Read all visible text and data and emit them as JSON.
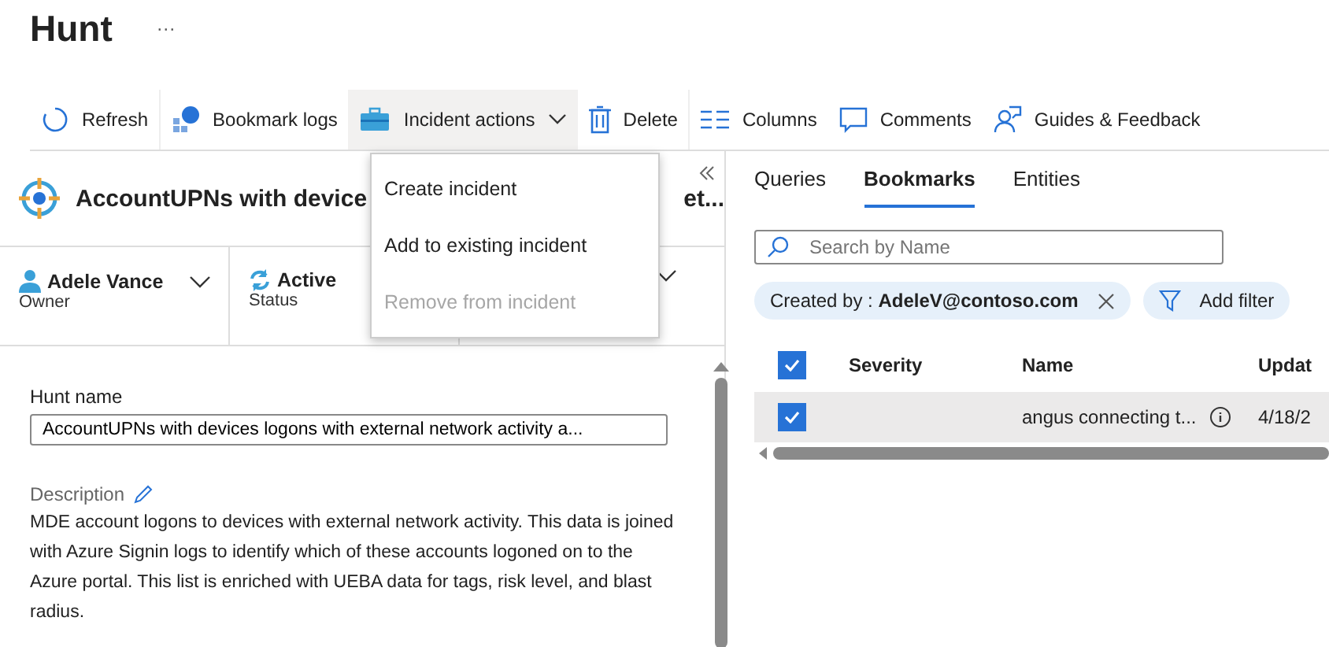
{
  "page_title": "Hunt",
  "more": "···",
  "toolbar": [
    {
      "label": "Refresh",
      "selected": false
    },
    {
      "label": "Bookmark logs",
      "selected": false
    },
    {
      "label": "Incident actions",
      "selected": true,
      "dropdown": true
    },
    {
      "label": "Delete",
      "selected": false
    },
    {
      "label": "Columns",
      "selected": false
    },
    {
      "label": "Comments",
      "selected": false
    },
    {
      "label": "Guides & Feedback",
      "selected": false
    }
  ],
  "menu": [
    {
      "label": "Create incident",
      "disabled": false
    },
    {
      "label": "Add to existing incident",
      "disabled": false
    },
    {
      "label": "Remove from incident",
      "disabled": true
    }
  ],
  "hunt": {
    "title_start": "AccountUPNs with device",
    "title_end": "et...",
    "cards": [
      {
        "value": "Adele Vance",
        "label": "Owner"
      },
      {
        "value": "Active",
        "label": "Status"
      }
    ],
    "name_label": "Hunt name",
    "name_value": "AccountUPNs with devices logons with external network activity a...",
    "description_label": "Description",
    "description": "MDE account logons to devices with external network activity. This data is joined with Azure Signin logs to identify which of these accounts logoned on to the Azure portal. This list is enriched with UEBA data for tags, risk level, and blast radius."
  },
  "tabs": [
    {
      "label": "Queries",
      "selected": false
    },
    {
      "label": "Bookmarks",
      "selected": true
    },
    {
      "label": "Entities",
      "selected": false
    }
  ],
  "search": {
    "placeholder": "Search by Name"
  },
  "filter": {
    "prefix": "Created by : ",
    "value": "AdeleV@contoso.com"
  },
  "add_filter": "Add filter",
  "table": {
    "all_checked": true,
    "columns": [
      "Severity",
      "Name",
      "Updat"
    ],
    "rows": [
      {
        "checked": true,
        "name": "angus connecting t...",
        "updated": "4/18/2"
      }
    ]
  }
}
